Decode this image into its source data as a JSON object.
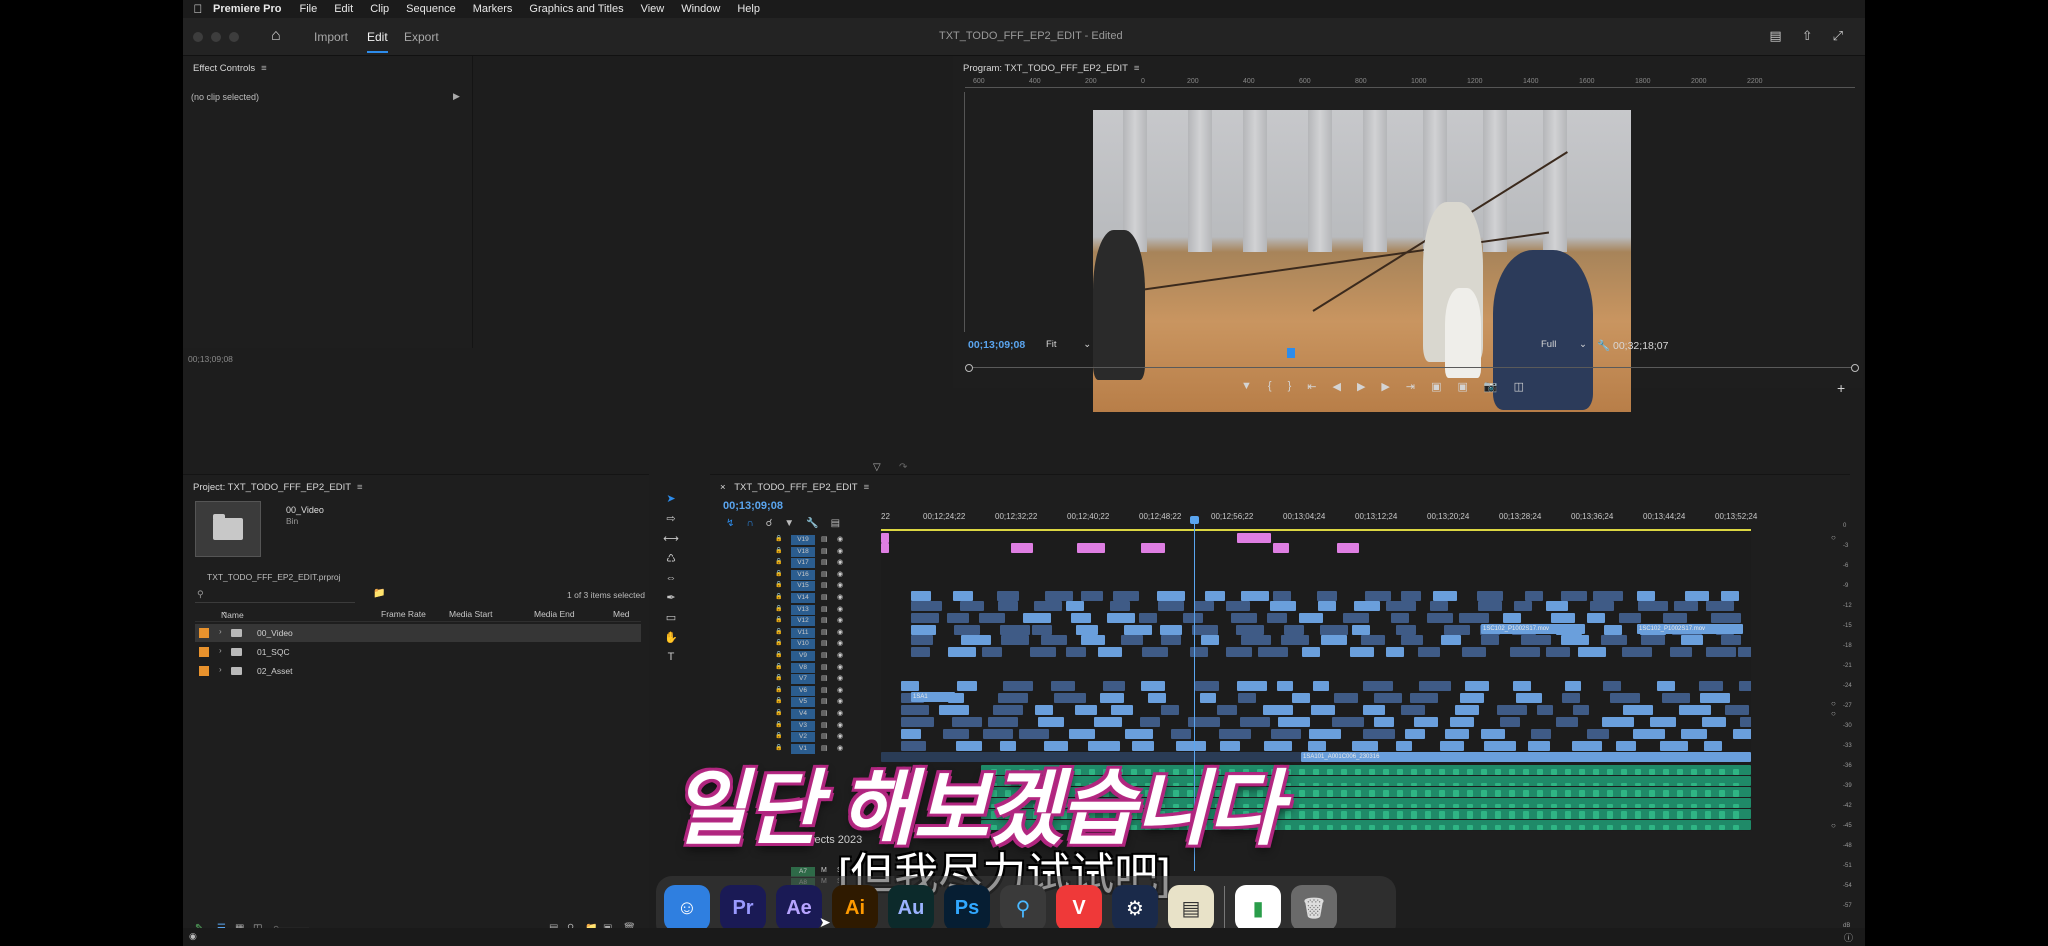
{
  "menubar": {
    "apple": "",
    "app_name": "Premiere Pro",
    "items": [
      "File",
      "Edit",
      "Clip",
      "Sequence",
      "Markers",
      "Graphics and Titles",
      "View",
      "Window",
      "Help"
    ]
  },
  "titlebar": {
    "tabs": [
      "Import",
      "Edit",
      "Export"
    ],
    "active_tab": "Edit",
    "document_title": "TXT_TODO_FFF_EP2_EDIT - Edited"
  },
  "effect_controls": {
    "title": "Effect Controls",
    "no_clip": "(no clip selected)",
    "timecode": "00;13;09;08"
  },
  "program_monitor": {
    "title": "Program: TXT_TODO_FFF_EP2_EDIT",
    "ruler_labels": [
      "600",
      "400",
      "200",
      "0",
      "200",
      "400",
      "600",
      "800",
      "1000",
      "1200",
      "1400",
      "1600",
      "1800",
      "2000",
      "2200"
    ],
    "timecode": "00;13;09;08",
    "fit": "Fit",
    "resolution": "Full",
    "duration": "00;32;18;07",
    "playhead_fraction": 0.36
  },
  "project": {
    "title": "Project: TXT_TODO_FFF_EP2_EDIT",
    "bin_name": "00_Video",
    "bin_type": "Bin",
    "file": "TXT_TODO_FFF_EP2_EDIT.prproj",
    "selection_count": "1 of 3 items selected",
    "columns": [
      "Name",
      "Frame Rate",
      "Media Start",
      "Media End",
      "Med"
    ],
    "items": [
      {
        "name": "00_Video",
        "color": "#e8922d"
      },
      {
        "name": "01_SQC",
        "color": "#e8922d"
      },
      {
        "name": "02_Asset",
        "color": "#e8922d"
      }
    ]
  },
  "timeline": {
    "title": "TXT_TODO_FFF_EP2_EDIT",
    "timecode": "00;13;09;08",
    "ticks": [
      "22",
      "00;12;24;22",
      "00;12;32;22",
      "00;12;40;22",
      "00;12;48;22",
      "00;12;56;22",
      "00;13;04;24",
      "00;13;12;24",
      "00;13;20;24",
      "00;13;28;24",
      "00;13;36;24",
      "00;13;44;24",
      "00;13;52;24"
    ],
    "video_tracks": [
      "V19",
      "V18",
      "V17",
      "V16",
      "V15",
      "V14",
      "V13",
      "V12",
      "V11",
      "V10",
      "V9",
      "V8",
      "V7",
      "V6",
      "V5",
      "V4",
      "V3",
      "V2",
      "V1"
    ],
    "audio_tracks": [
      "A7",
      "A8"
    ],
    "clip_labels": [
      "1SC102_P1002S17.mov",
      "1SA1",
      "1SA101_A001C006_230316"
    ],
    "meter_labels": [
      "0",
      "-3",
      "-6",
      "-9",
      "-12",
      "-15",
      "-18",
      "-21",
      "-24",
      "-27",
      "-30",
      "-33",
      "-36",
      "-39",
      "-42",
      "-45",
      "-48",
      "-51",
      "-54",
      "-57",
      "dB"
    ]
  },
  "overlay": {
    "subtitle_korean": "일단 해보겠습니다",
    "subtitle_chinese": "[但我尽力试试吧]",
    "ae_label": "After Effects 2023"
  },
  "dock": {
    "apps": [
      {
        "name": "Finder",
        "label": "",
        "bg": "#2f7fe0",
        "fg": "#ffffff"
      },
      {
        "name": "Premiere Pro",
        "label": "Pr",
        "bg": "#1a1a55",
        "fg": "#9999ff"
      },
      {
        "name": "After Effects",
        "label": "Ae",
        "bg": "#1a1a55",
        "fg": "#b7a4ff"
      },
      {
        "name": "Illustrator",
        "label": "Ai",
        "bg": "#2f1a00",
        "fg": "#ff9a00"
      },
      {
        "name": "Audition",
        "label": "Au",
        "bg": "#0c2a2b",
        "fg": "#9bb3ff"
      },
      {
        "name": "Photoshop",
        "label": "Ps",
        "bg": "#061e33",
        "fg": "#31a8ff"
      },
      {
        "name": "QuickTime",
        "label": "",
        "bg": "#3a3a3a",
        "fg": "#4ab8ff"
      },
      {
        "name": "Vivaldi",
        "label": "",
        "bg": "#ef3939",
        "fg": "#ffffff"
      },
      {
        "name": "Steam",
        "label": "",
        "bg": "#1a2a4a",
        "fg": "#ffffff"
      },
      {
        "name": "Notes",
        "label": "",
        "bg": "#e8e2c8",
        "fg": "#333333"
      },
      {
        "name": "Numbers",
        "label": "",
        "bg": "#ffffff",
        "fg": "#2a9d4a"
      },
      {
        "name": "Trash",
        "label": "",
        "bg": "#6a6a6a",
        "fg": "#dddddd"
      }
    ]
  }
}
